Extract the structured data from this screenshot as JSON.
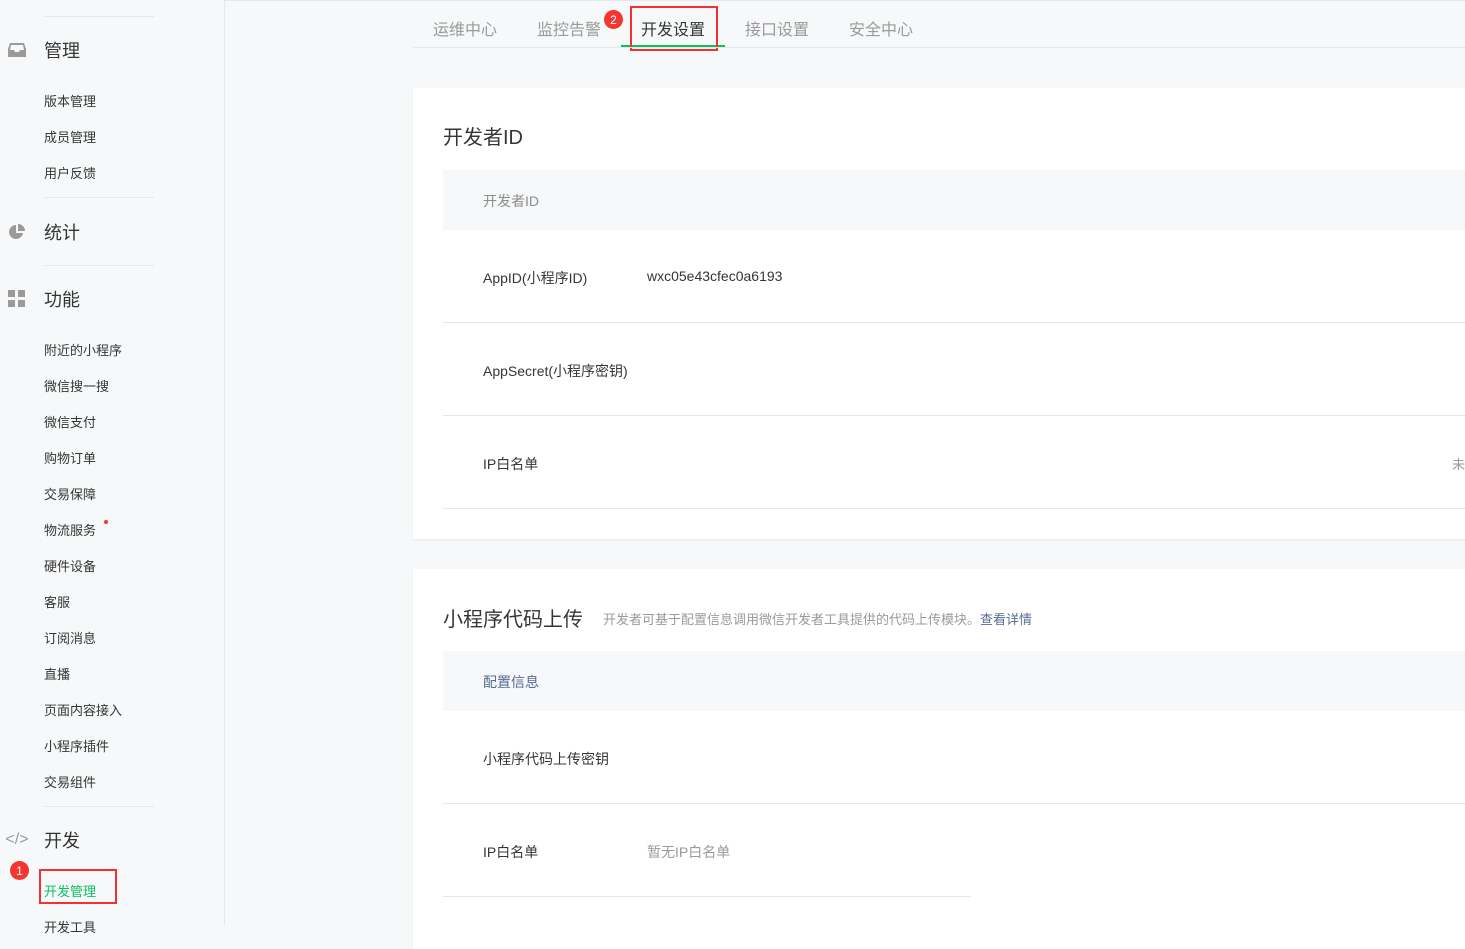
{
  "sidebar": {
    "sections": [
      {
        "label": "管理",
        "icon": "inbox-icon",
        "items": [
          "版本管理",
          "成员管理",
          "用户反馈"
        ]
      },
      {
        "label": "统计",
        "icon": "pie-chart-icon",
        "items": []
      },
      {
        "label": "功能",
        "icon": "grid-icon",
        "items": [
          "附近的小程序",
          "微信搜一搜",
          "微信支付",
          "购物订单",
          "交易保障",
          "物流服务",
          "硬件设备",
          "客服",
          "订阅消息",
          "直播",
          "页面内容接入",
          "小程序插件",
          "交易组件"
        ]
      },
      {
        "label": "开发",
        "icon": "code-icon",
        "items": [
          "开发管理",
          "开发工具"
        ]
      }
    ],
    "step_badge": "1"
  },
  "tabs": {
    "items": [
      "运维中心",
      "监控告警",
      "开发设置",
      "接口设置",
      "安全中心"
    ],
    "active": "开发设置",
    "step_badge": "2"
  },
  "developer_id": {
    "title": "开发者ID",
    "header": "开发者ID",
    "rows": [
      {
        "label": "AppID(小程序ID)",
        "value": "wxc05e43cfec0a6193"
      },
      {
        "label": "AppSecret(小程序密钥)",
        "value": ""
      },
      {
        "label": "IP白名单",
        "value": "未"
      }
    ]
  },
  "code_upload": {
    "title": "小程序代码上传",
    "description": "开发者可基于配置信息调用微信开发者工具提供的代码上传模块。",
    "link": "查看详情",
    "header": "配置信息",
    "rows": [
      {
        "label": "小程序代码上传密钥",
        "value": ""
      },
      {
        "label": "IP白名单",
        "value": "暂无IP白名单"
      }
    ]
  },
  "colors": {
    "accent": "#07c160",
    "badge": "#f43530",
    "link": "#576b95",
    "highlight_box": "#f03232"
  }
}
